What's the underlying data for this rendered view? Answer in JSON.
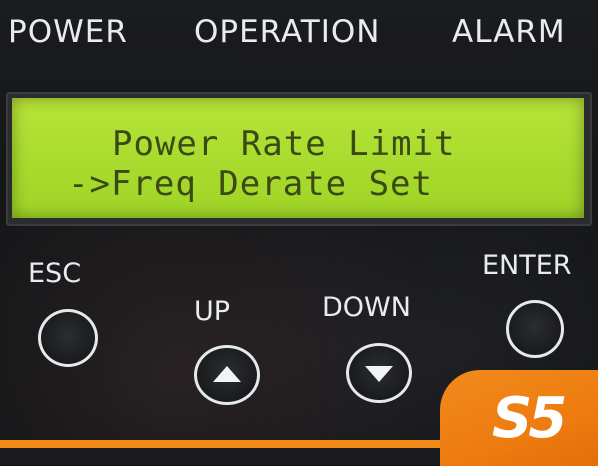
{
  "header": {
    "power_label": "POWER",
    "operation_label": "OPERATION",
    "alarm_label": "ALARM"
  },
  "lcd": {
    "line1": "Power Rate Limit",
    "line2": "->Freq Derate Set",
    "background_color": "#a9dc2e",
    "text_color": "#3b4a14"
  },
  "buttons": {
    "esc_label": "ESC",
    "up_label": "UP",
    "down_label": "DOWN",
    "enter_label": "ENTER"
  },
  "brand": {
    "mark": "S5",
    "color": "#f08a1c"
  }
}
